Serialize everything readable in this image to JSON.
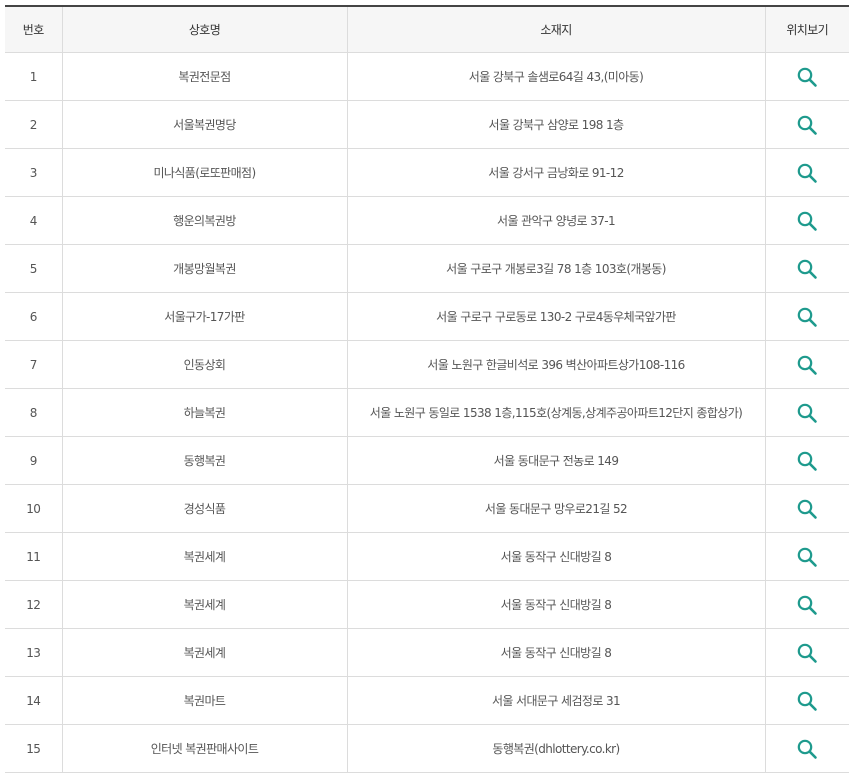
{
  "table": {
    "headers": {
      "no": "번호",
      "name": "상호명",
      "address": "소재지",
      "location": "위치보기"
    },
    "icon": "search-icon",
    "accent_color": "#1e9a8d",
    "rows": [
      {
        "no": "1",
        "name": "복권전문점",
        "address": "서울 강북구 솔샘로64길 43,(미아동)"
      },
      {
        "no": "2",
        "name": "서울복권명당",
        "address": "서울 강북구 삼양로 198 1층"
      },
      {
        "no": "3",
        "name": "미나식품(로또판매점)",
        "address": "서울 강서구 금낭화로 91-12"
      },
      {
        "no": "4",
        "name": "행운의복권방",
        "address": "서울 관악구 양녕로 37-1"
      },
      {
        "no": "5",
        "name": "개봉망월복권",
        "address": "서울 구로구 개봉로3길 78 1층 103호(개봉동)"
      },
      {
        "no": "6",
        "name": "서울구가-17가판",
        "address": "서울 구로구 구로동로 130-2 구로4동우체국앞가판"
      },
      {
        "no": "7",
        "name": "인동상회",
        "address": "서울 노원구 한글비석로 396 벽산아파트상가108-116"
      },
      {
        "no": "8",
        "name": "하늘복권",
        "address": "서울 노원구 동일로 1538 1층,115호(상계동,상계주공아파트12단지 종합상가)"
      },
      {
        "no": "9",
        "name": "동행복권",
        "address": "서울 동대문구 전농로 149"
      },
      {
        "no": "10",
        "name": "경성식품",
        "address": "서울 동대문구 망우로21길 52"
      },
      {
        "no": "11",
        "name": "복권세계",
        "address": "서울 동작구 신대방길 8"
      },
      {
        "no": "12",
        "name": "복권세계",
        "address": "서울 동작구 신대방길 8"
      },
      {
        "no": "13",
        "name": "복권세계",
        "address": "서울 동작구 신대방길 8"
      },
      {
        "no": "14",
        "name": "복권마트",
        "address": "서울 서대문구 세검정로 31"
      },
      {
        "no": "15",
        "name": "인터넷 복권판매사이트",
        "address": "동행복권(dhlottery.co.kr)"
      }
    ]
  }
}
